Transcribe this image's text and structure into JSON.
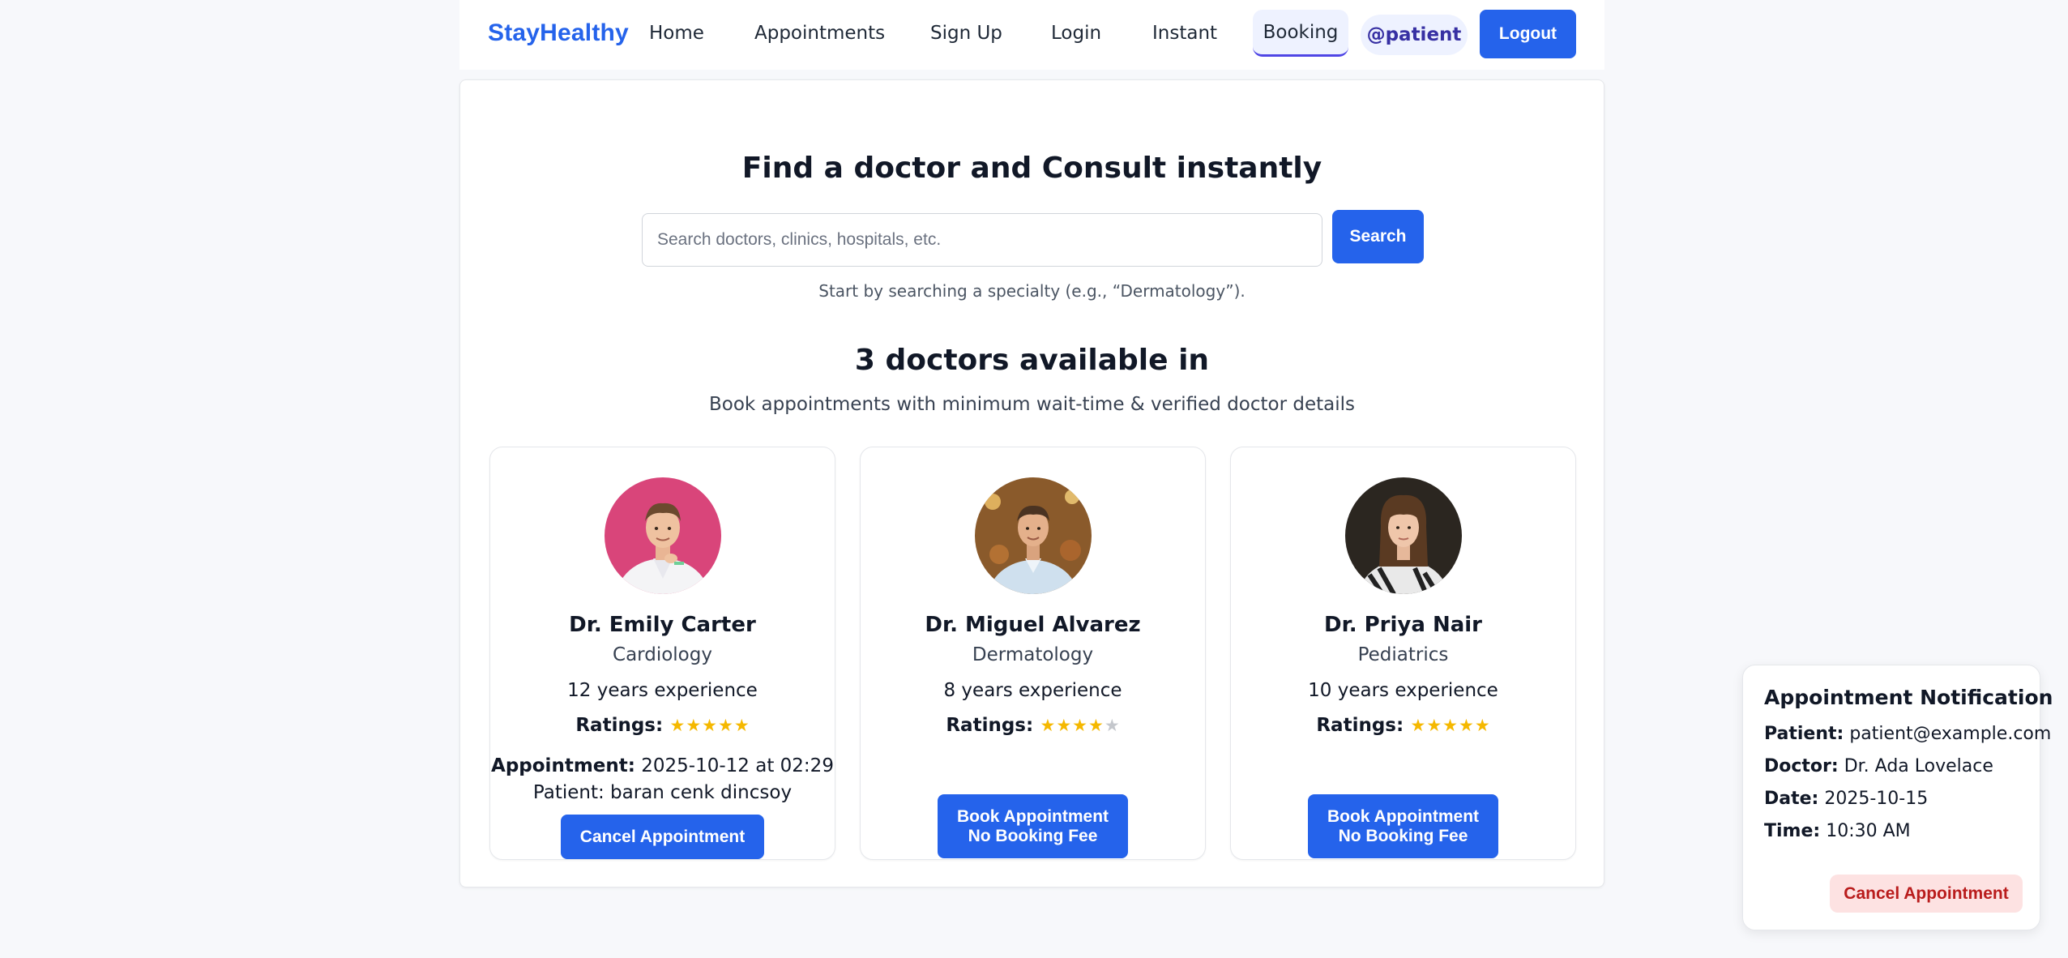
{
  "navbar": {
    "brand": "StayHealthy",
    "links": [
      "Home",
      "Appointments",
      "Sign Up",
      "Login",
      "Instant",
      "Booking"
    ],
    "user": "@patient",
    "logout": "Logout"
  },
  "hero": {
    "title": "Find a doctor and Consult instantly",
    "search_placeholder": "Search doctors, clinics, hospitals, etc.",
    "search_value": "",
    "search_button": "Search",
    "hint": "Start by searching a specialty (e.g., “Dermatology”)."
  },
  "results": {
    "title": "3 doctors available in",
    "subtitle": "Book appointments with minimum wait-time & verified doctor details",
    "ratings_label": "Ratings:",
    "doctors": [
      {
        "name": "Dr. Emily Carter",
        "specialty": "Cardiology",
        "experience": "12 years experience",
        "rating": 5,
        "avatar_bg": "#d9457a",
        "appointment_label": "Appointment:",
        "appointment_value": "2025-10-12 at 02:29",
        "appointment_patient": "Patient: baran cenk dincsoy",
        "action": "Cancel Appointment"
      },
      {
        "name": "Dr. Miguel Alvarez",
        "specialty": "Dermatology",
        "experience": "8 years experience",
        "rating": 4,
        "avatar_bg": "#8a5a2b",
        "action_line1": "Book Appointment",
        "action_line2": "No Booking Fee"
      },
      {
        "name": "Dr. Priya Nair",
        "specialty": "Pediatrics",
        "experience": "10 years experience",
        "rating": 5,
        "avatar_bg": "#2b2620",
        "action_line1": "Book Appointment",
        "action_line2": "No Booking Fee"
      }
    ]
  },
  "notification": {
    "title": "Appointment Notification",
    "patient_label": "Patient:",
    "patient_value": "patient@example.com",
    "doctor_label": "Doctor:",
    "doctor_value": "Dr. Ada Lovelace",
    "date_label": "Date:",
    "date_value": "2025-10-15",
    "time_label": "Time:",
    "time_value": "10:30 AM",
    "cancel": "Cancel Appointment"
  },
  "colors": {
    "accent": "#2563eb",
    "star": "#f5b800",
    "danger_text": "#b91c1c",
    "danger_bg": "#fde2e2"
  }
}
